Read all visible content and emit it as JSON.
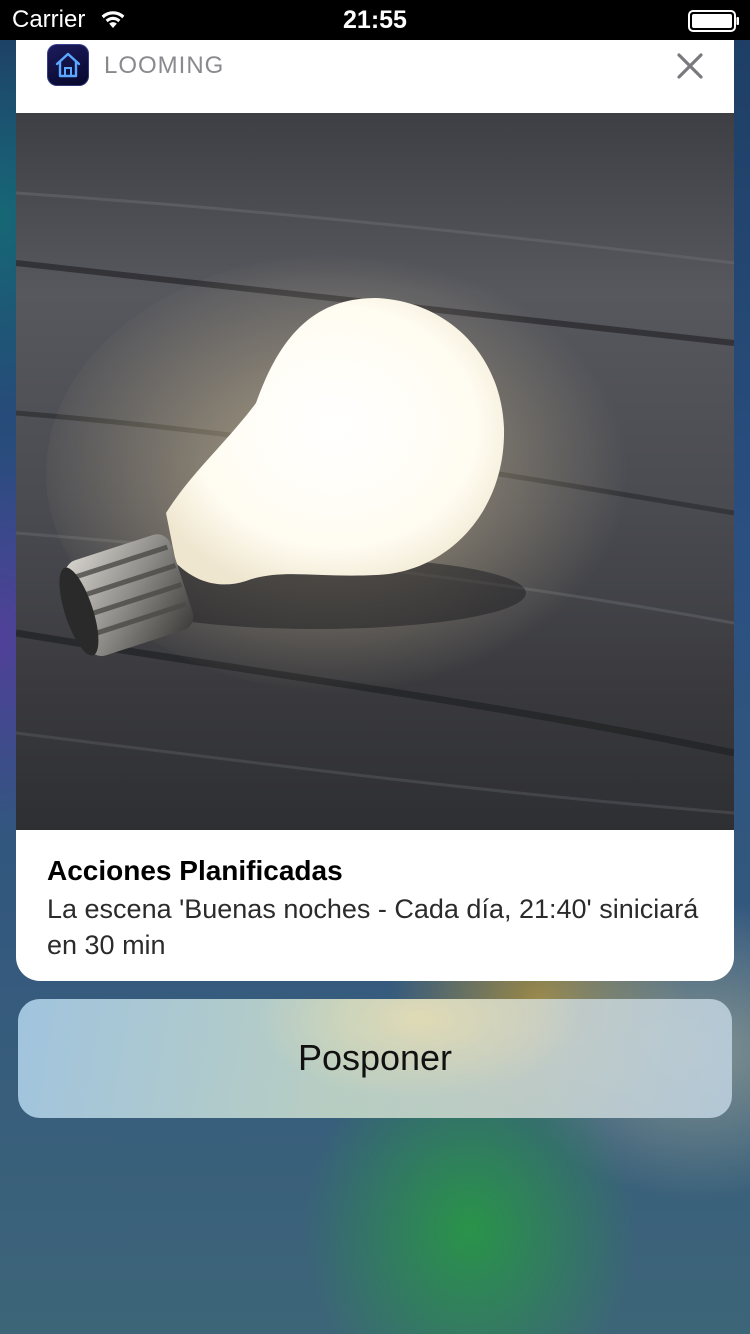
{
  "status_bar": {
    "carrier": "Carrier",
    "time": "21:55",
    "wifi_icon": "wifi-icon",
    "battery_icon": "battery-icon"
  },
  "notification": {
    "app_name": "LOOMING",
    "app_icon": "house-icon",
    "close_icon": "close-icon",
    "image": "lightbulb-on-wood-photo",
    "title": "Acciones Planificadas",
    "body": "La escena 'Buenas noches - Cada día, 21:40' siniciará en 30 min"
  },
  "actions": [
    {
      "label": "Posponer"
    }
  ],
  "colors": {
    "card_background": "#ffffff",
    "app_name_gray": "#8a8a8e",
    "status_bar_background": "#000000",
    "app_icon_background": "#0b0b3a"
  }
}
